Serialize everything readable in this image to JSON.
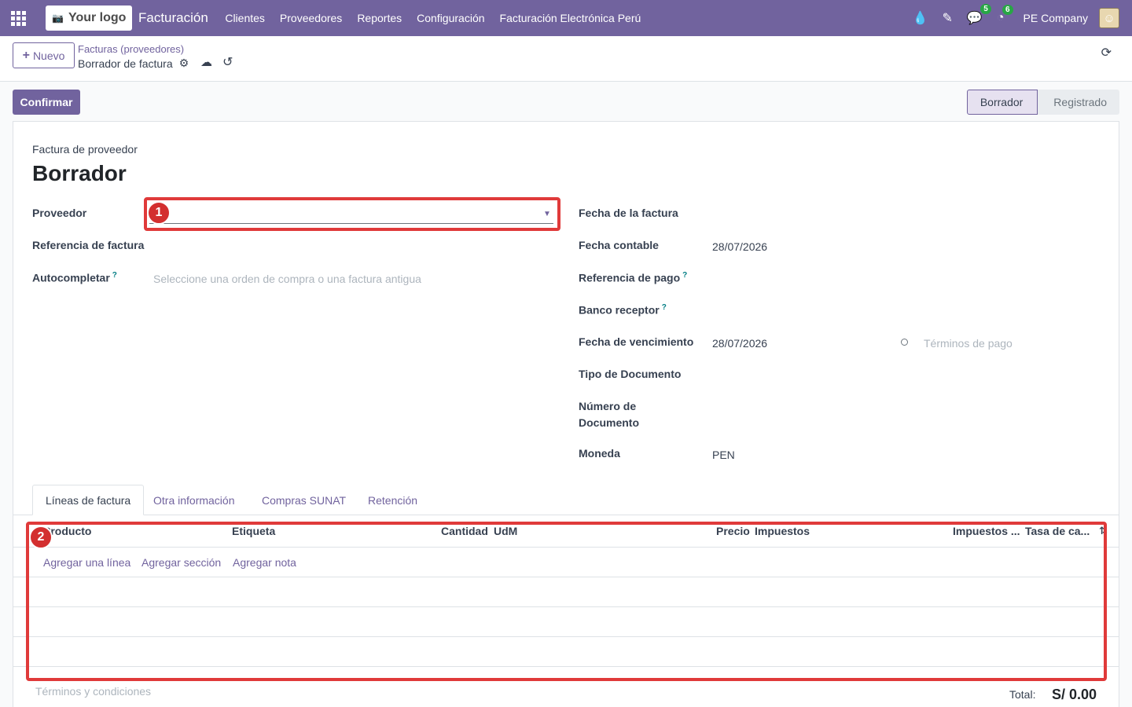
{
  "navbar": {
    "logo_text": "Your logo",
    "app_name": "Facturación",
    "menu": [
      "Clientes",
      "Proveedores",
      "Reportes",
      "Configuración",
      "Facturación Electrónica Perú"
    ],
    "messages_count": "5",
    "activities_count": "6",
    "company": "PE Company"
  },
  "control_panel": {
    "new_label": "Nuevo",
    "breadcrumb_parent": "Facturas (proveedores)",
    "breadcrumb_current": "Borrador de factura"
  },
  "actions": {
    "confirm_label": "Confirmar"
  },
  "statusbar": {
    "stages": [
      "Borrador",
      "Registrado"
    ],
    "current": "Borrador"
  },
  "form": {
    "subtitle": "Factura de proveedor",
    "title": "Borrador",
    "left": {
      "proveedor_label": "Proveedor",
      "referencia_label": "Referencia de factura",
      "autocompletar_label": "Autocompletar",
      "autocompletar_placeholder": "Seleccione una orden de compra o una factura antigua"
    },
    "right": {
      "fecha_factura_label": "Fecha de la factura",
      "fecha_contable_label": "Fecha contable",
      "fecha_contable_value": "28/07/2026",
      "referencia_pago_label": "Referencia de pago",
      "banco_receptor_label": "Banco receptor",
      "fecha_vencimiento_label": "Fecha de vencimiento",
      "fecha_vencimiento_value": "28/07/2026",
      "terminos_pago_placeholder": "Términos de pago",
      "tipo_documento_label": "Tipo de Documento",
      "numero_documento_label_1": "Número de",
      "numero_documento_label_2": "Documento",
      "moneda_label": "Moneda",
      "moneda_value": "PEN"
    }
  },
  "annotations": [
    "1",
    "2"
  ],
  "tabs": [
    "Líneas de factura",
    "Otra información",
    "Compras SUNAT",
    "Retención"
  ],
  "table": {
    "headers": [
      "Producto",
      "Etiqueta",
      "Cantidad",
      "UdM",
      "Precio",
      "Impuestos",
      "Impuestos ...",
      "Tasa de ca..."
    ],
    "add_links": [
      "Agregar una línea",
      "Agregar sección",
      "Agregar nota"
    ]
  },
  "footer": {
    "terms_placeholder": "Términos y condiciones",
    "total_label": "Total:",
    "total_value": "S/ 0.00"
  },
  "colors": {
    "brand": "#71639e",
    "annotation": "#e03a3a",
    "badge": "#28a745"
  }
}
